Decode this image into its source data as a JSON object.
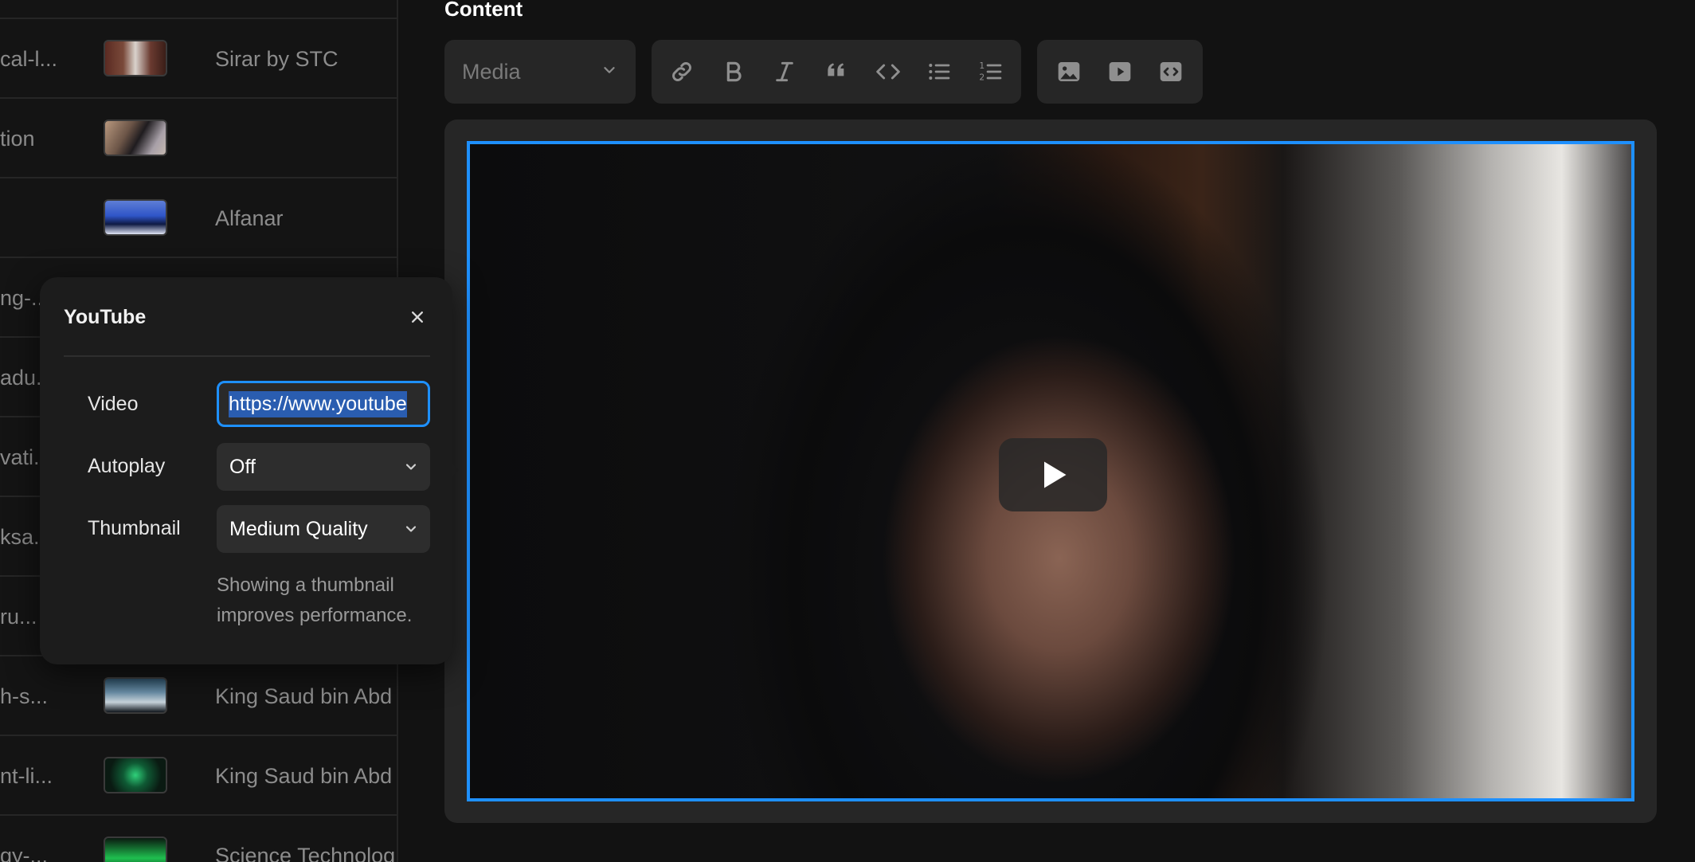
{
  "list": {
    "rows": [
      {
        "slug": "cal-l...",
        "company": "Sirar by STC"
      },
      {
        "slug": "tion",
        "company": ""
      },
      {
        "slug": "",
        "company": "Alfanar"
      },
      {
        "slug": "ng-...",
        "company": ""
      },
      {
        "slug": "adu...",
        "company": ""
      },
      {
        "slug": "vati...",
        "company": ""
      },
      {
        "slug": "ksa...",
        "company": ""
      },
      {
        "slug": "ru...",
        "company": ""
      },
      {
        "slug": "h-s...",
        "company": "King Saud bin Abd"
      },
      {
        "slug": "nt-li...",
        "company": "King Saud bin Abd"
      },
      {
        "slug": "gy-...",
        "company": "Science Technolog"
      }
    ]
  },
  "content": {
    "label": "Content",
    "block_type": "Media",
    "toolbar_icons": [
      "link-icon",
      "bold-icon",
      "italic-icon",
      "quote-icon",
      "code-icon",
      "bullet-list-icon",
      "numbered-list-icon"
    ],
    "embed_icons": [
      "image-icon",
      "video-icon",
      "embed-icon"
    ],
    "accent_color": "#1e90ff"
  },
  "popover": {
    "title": "YouTube",
    "video_label": "Video",
    "video_value": "https://www.youtube",
    "autoplay_label": "Autoplay",
    "autoplay_value": "Off",
    "thumbnail_label": "Thumbnail",
    "thumbnail_value": "Medium Quality",
    "help_text": "Showing a thumbnail improves performance."
  }
}
